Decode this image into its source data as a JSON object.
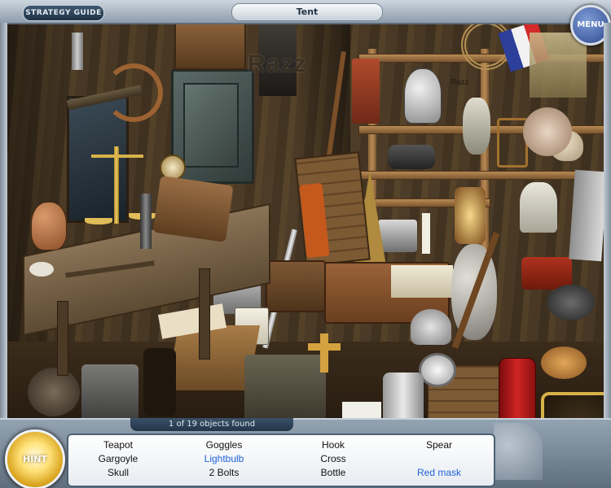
{
  "window": {
    "scene_title": "Tent",
    "guide_label": "STRATEGY GUIDE",
    "menu_label": "MENU"
  },
  "scene": {
    "watermark": "Razz",
    "watermark_small": "Razz"
  },
  "status": {
    "found_text": "1 of 19 objects found"
  },
  "hint": {
    "label": "HINT"
  },
  "object_list": [
    {
      "label": "Teapot",
      "found": false
    },
    {
      "label": "Goggles",
      "found": false
    },
    {
      "label": "Hook",
      "found": false
    },
    {
      "label": "Spear",
      "found": false
    },
    {
      "label": "Gargoyle",
      "found": false
    },
    {
      "label": "Lightbulb",
      "found": true
    },
    {
      "label": "Cross",
      "found": false
    },
    {
      "label": "Red mask",
      "found": true
    },
    {
      "label": "Skull",
      "found": false
    },
    {
      "label": "2 Bolts",
      "found": false
    },
    {
      "label": "Bottle",
      "found": false
    }
  ],
  "colors": {
    "found_item": "#1f63d8",
    "default_item": "#111111",
    "hint_glow": "#ffe27a",
    "panel": "#5e6d7c"
  }
}
